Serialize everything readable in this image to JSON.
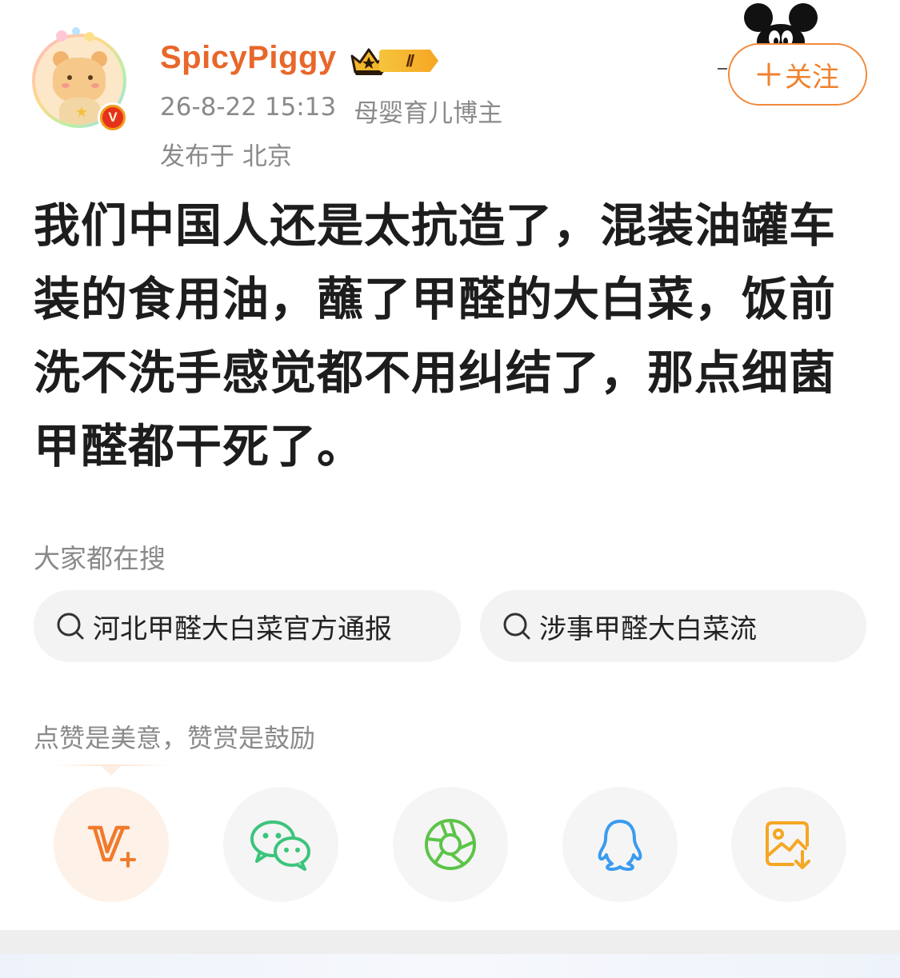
{
  "header": {
    "username": "SpicyPiggy",
    "level": "Ⅱ",
    "timestamp": "26-8-22 15:13",
    "user_category": "母婴育儿博主",
    "location": "发布于 北京",
    "follow_label": "关注",
    "follow_icon": "plus-icon",
    "verified_mark": "V"
  },
  "post": {
    "text": "我们中国人还是太抗造了，混装油罐车装的食用油，蘸了甲醛的大白菜，饭前洗不洗手感觉都不用纠结了，那点细菌甲醛都干死了。"
  },
  "trending": {
    "label": "大家都在搜",
    "items": [
      {
        "text": "河北甲醛大白菜官方通报",
        "icon": "search-icon"
      },
      {
        "text": "涉事甲醛大白菜流",
        "icon": "search-icon"
      }
    ]
  },
  "reward": {
    "label": "点赞是美意，赞赏是鼓励"
  },
  "share": {
    "items": [
      {
        "icon": "vplus-reward-icon",
        "color": "#f07a2c"
      },
      {
        "icon": "wechat-icon",
        "color": "#3cc47c"
      },
      {
        "icon": "moments-icon",
        "color": "#5cc448"
      },
      {
        "icon": "qq-icon",
        "color": "#3a9bf0"
      },
      {
        "icon": "save-image-icon",
        "color": "#f5a623"
      }
    ]
  },
  "colors": {
    "username": "#e8672a",
    "follow": "#f0822e",
    "meta": "#8a8a8a",
    "chip_bg": "#f3f3f3"
  }
}
